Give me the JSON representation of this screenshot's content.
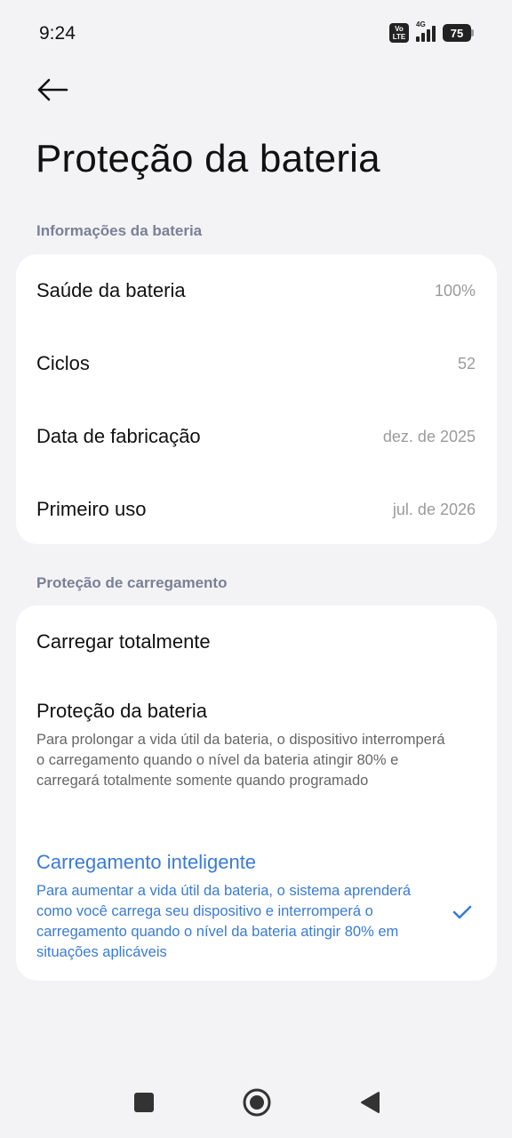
{
  "status_bar": {
    "time": "9:24",
    "volte_top": "Vo",
    "volte_bottom": "LTE",
    "network_type": "4G",
    "battery_level": "75"
  },
  "header": {
    "title": "Proteção da bateria"
  },
  "battery_info": {
    "section_title": "Informações da bateria",
    "rows": [
      {
        "label": "Saúde da bateria",
        "value": "100%"
      },
      {
        "label": "Ciclos",
        "value": "52"
      },
      {
        "label": "Data de fabricação",
        "value": "dez. de 2025"
      },
      {
        "label": "Primeiro uso",
        "value": "jul. de 2026"
      }
    ]
  },
  "charging_protection": {
    "section_title": "Proteção de carregamento",
    "options": [
      {
        "title": "Carregar totalmente",
        "description": ""
      },
      {
        "title": "Proteção da bateria",
        "description": "Para prolongar a vida útil da bateria, o dispositivo interromperá o carregamento quando o nível da bateria atingir 80% e carregará totalmente somente quando programado"
      },
      {
        "title": "Carregamento inteligente",
        "description": "Para aumentar a vida útil da bateria, o sistema aprenderá como você carrega seu dispositivo e interromperá o carregamento quando o nível da bateria atingir 80% em situações aplicáveis"
      }
    ],
    "selected_option": "Carregamento inteligente"
  },
  "colors": {
    "accent": "#3a7bd5",
    "background": "#f3f3f5",
    "card": "#ffffff",
    "section_header": "#7a8096"
  },
  "icons": {
    "back": "arrow-left-icon",
    "check": "check-icon",
    "nav_recents": "square-icon",
    "nav_home": "circle-icon",
    "nav_back": "triangle-icon"
  }
}
